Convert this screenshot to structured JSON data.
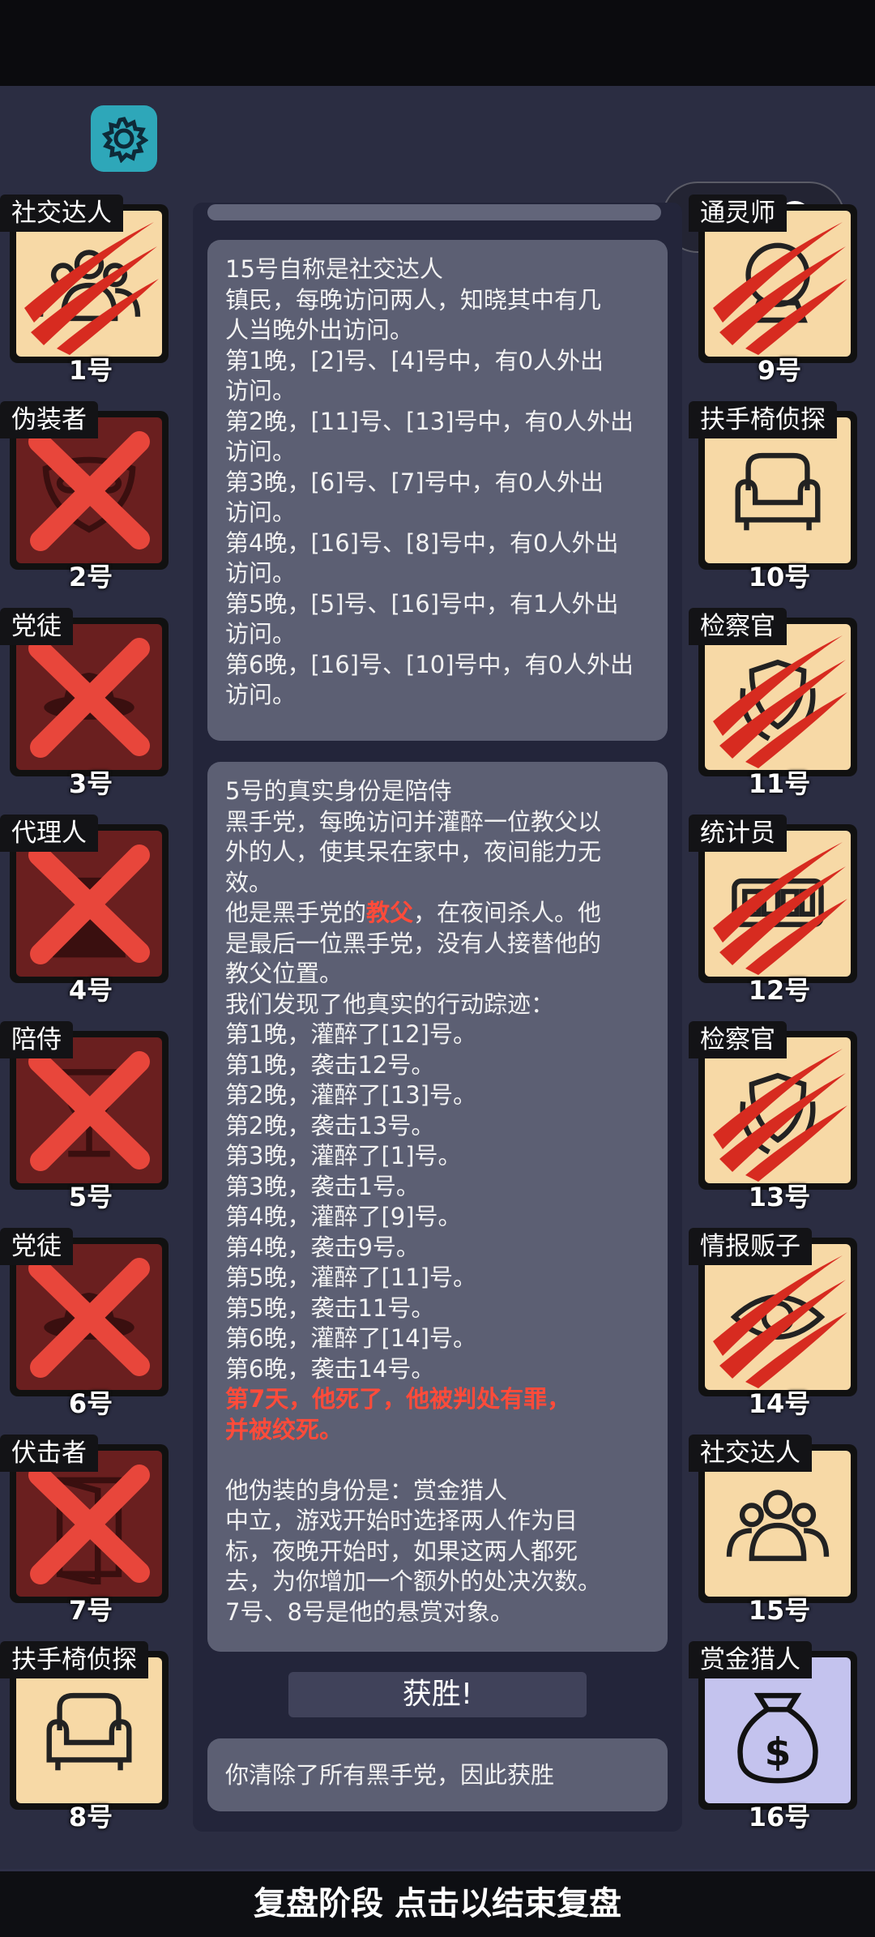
{
  "bottom_bar": "复盘阶段 点击以结束复盘",
  "win_button": "获胜!",
  "left_cards": [
    {
      "role": "社交达人",
      "seat": "1号",
      "state": "claw",
      "icon": "crowd-icon"
    },
    {
      "role": "伪装者",
      "seat": "2号",
      "state": "x",
      "icon": "mask-icon"
    },
    {
      "role": "党徒",
      "seat": "3号",
      "state": "x",
      "icon": "hat-icon"
    },
    {
      "role": "代理人",
      "seat": "4号",
      "state": "x",
      "icon": "agent-icon"
    },
    {
      "role": "陪侍",
      "seat": "5号",
      "state": "x",
      "icon": "wineglass-icon"
    },
    {
      "role": "党徒",
      "seat": "6号",
      "state": "x",
      "icon": "hat-icon"
    },
    {
      "role": "伏击者",
      "seat": "7号",
      "state": "x",
      "icon": "door-icon"
    },
    {
      "role": "扶手椅侦探",
      "seat": "8号",
      "state": "alive",
      "icon": "armchair-icon"
    }
  ],
  "right_cards": [
    {
      "role": "通灵师",
      "seat": "9号",
      "state": "claw",
      "icon": "crystal-ball-icon"
    },
    {
      "role": "扶手椅侦探",
      "seat": "10号",
      "state": "alive",
      "icon": "armchair-icon"
    },
    {
      "role": "检察官",
      "seat": "11号",
      "state": "claw",
      "icon": "laurel-shield-icon"
    },
    {
      "role": "统计员",
      "seat": "12号",
      "state": "claw",
      "icon": "counter-icon"
    },
    {
      "role": "检察官",
      "seat": "13号",
      "state": "claw",
      "icon": "laurel-shield-icon"
    },
    {
      "role": "情报贩子",
      "seat": "14号",
      "state": "claw",
      "icon": "eye-icon"
    },
    {
      "role": "社交达人",
      "seat": "15号",
      "state": "alive",
      "icon": "crowd-icon"
    },
    {
      "role": "赏金猎人",
      "seat": "16号",
      "state": "bounty",
      "icon": "money-bag-icon"
    }
  ],
  "message1": [
    "15号自称是社交达人",
    "镇民，每晚访问两人，知晓其中有几",
    "人当晚外出访问。",
    "第1晚，[2]号、[4]号中，有0人外出",
    "访问。",
    "第2晚，[11]号、[13]号中，有0人外出",
    "访问。",
    "第3晚，[6]号、[7]号中，有0人外出",
    "访问。",
    "第4晚，[16]号、[8]号中，有0人外出",
    "访问。",
    "第5晚，[5]号、[16]号中，有1人外出",
    "访问。",
    "第6晚，[16]号、[10]号中，有0人外出",
    "访问。"
  ],
  "message2": {
    "lines_a": [
      "5号的真实身份是陪侍",
      "黑手党，每晚访问并灌醉一位教父以",
      "外的人，使其呆在家中，夜间能力无",
      "效。"
    ],
    "godfather_pre": "他是黑手党的",
    "godfather_word": "教父",
    "godfather_post": "，在夜间杀人。他",
    "lines_b": [
      "是最后一位黑手党，没有人接替他的",
      "教父位置。",
      "我们发现了他真实的行动踪迹：",
      "第1晚，灌醉了[12]号。",
      "第1晚，袭击12号。",
      "第2晚，灌醉了[13]号。",
      "第2晚，袭击13号。",
      "第3晚，灌醉了[1]号。",
      "第3晚，袭击1号。",
      "第4晚，灌醉了[9]号。",
      "第4晚，袭击9号。",
      "第5晚，灌醉了[11]号。",
      "第5晚，袭击11号。",
      "第6晚，灌醉了[14]号。",
      "第6晚，袭击14号。"
    ],
    "death_lines": [
      "第7天，他死了，他被判处有罪，",
      "并被绞死。"
    ],
    "lines_c": [
      "他伪装的身份是：赏金猎人",
      "中立，游戏开始时选择两人作为目",
      "标，夜晚开始时，如果这两人都死",
      "去，为你增加一个额外的处决次数。",
      "7号、8号是他的悬赏对象。"
    ]
  },
  "message3": "你清除了所有黑手党，因此获胜",
  "colors": {
    "background": "#2b2d42",
    "alive_card": "#f7d9a6",
    "dead_card": "#6a1f1f",
    "bounty_card": "#c4c3ee",
    "highlight": "#ff4b3a",
    "gear": "#2ea7b9"
  }
}
